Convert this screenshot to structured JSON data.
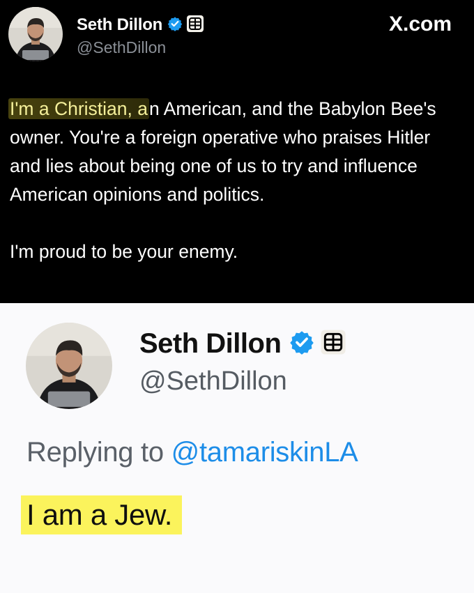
{
  "top_post": {
    "author_name": "Seth Dillon",
    "handle": "@SethDillon",
    "source_label": "X.com",
    "highlighted_text": "I'm a Christian, a",
    "body_rest": "n American, and the Babylon Bee's owner. You're a foreign operative who praises Hitler and lies about being one of us to try and influence American opinions and politics.",
    "closing_line": "I'm proud to be your enemy.",
    "icons": [
      "avatar-photo",
      "verified-badge-icon",
      "babylon-bee-logo-icon"
    ]
  },
  "bottom_post": {
    "author_name": "Seth Dillon",
    "handle": "@SethDillon",
    "reply_prefix": "Replying to",
    "reply_mention": "@tamariskinLA",
    "highlighted_text": "I am a Jew.",
    "icons": [
      "avatar-photo",
      "verified-badge-icon",
      "babylon-bee-logo-icon"
    ]
  },
  "colors": {
    "verified_blue": "#1d9bf0",
    "mention_blue": "#1d8de8",
    "highlight_yellow": "#fbf35c",
    "top_background": "#000000",
    "bottom_background": "#fafafc"
  }
}
